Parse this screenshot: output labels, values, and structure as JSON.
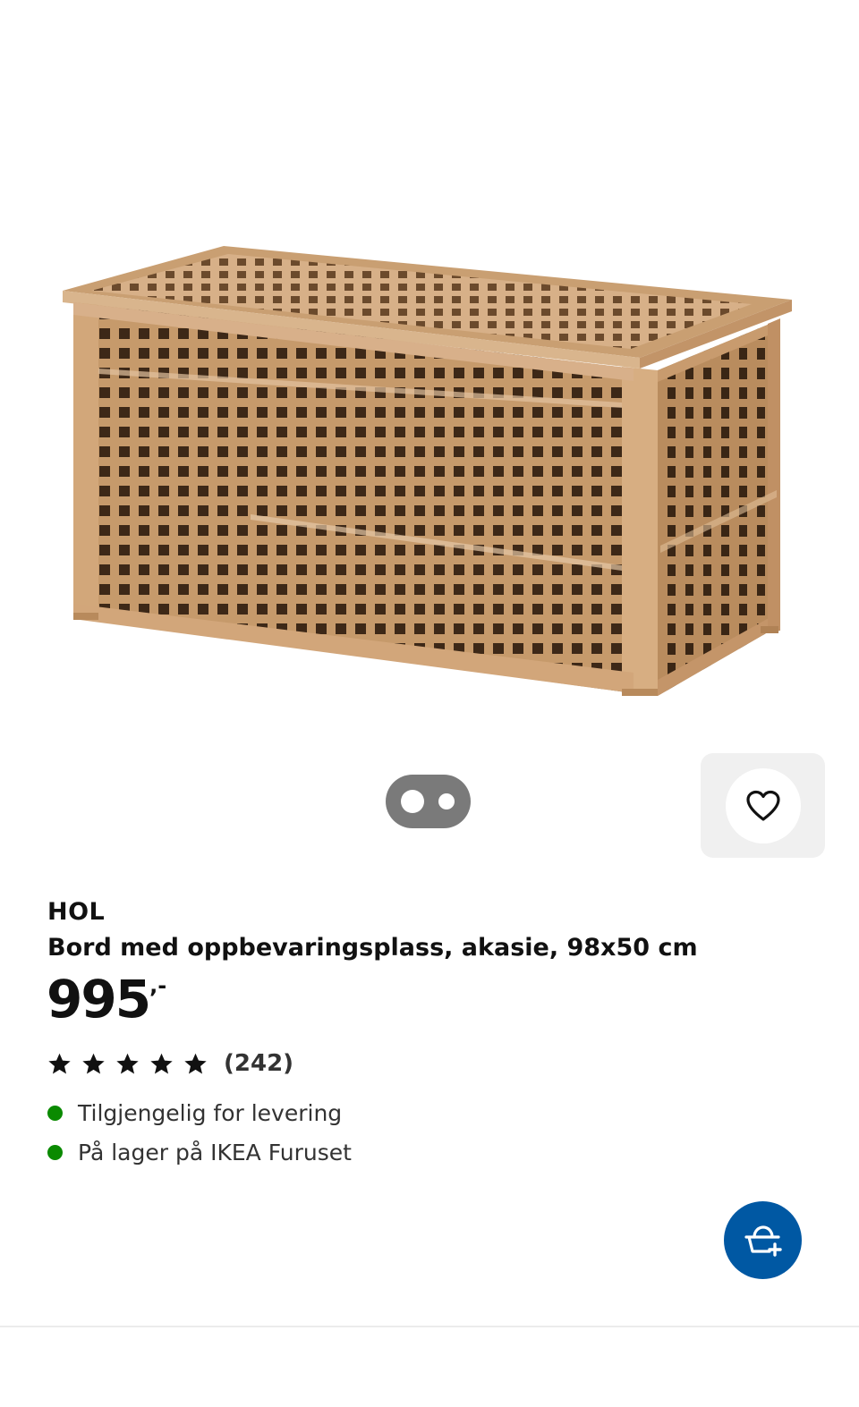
{
  "product": {
    "brand": "HOL",
    "description": "Bord med oppbevaringsplass, akasie, 98x50 cm",
    "price": "995",
    "price_suffix": ",-",
    "rating": {
      "stars": 5,
      "count": "(242)"
    },
    "availability": [
      {
        "text": "Tilgjengelig for levering",
        "status_color": "#0a8a00"
      },
      {
        "text": "På lager på IKEA Furuset",
        "status_color": "#0a8a00"
      }
    ]
  },
  "carousel": {
    "total_images": 2,
    "active_index": 0
  },
  "icons": {
    "favourite": "heart-icon",
    "add_to_cart": "shopping-bag-add-icon"
  },
  "colors": {
    "brand_blue": "#0058a3",
    "availability_green": "#0a8a00"
  }
}
